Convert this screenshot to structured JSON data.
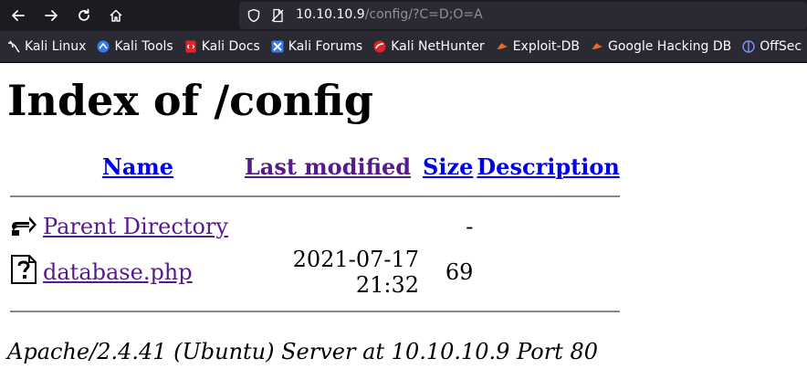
{
  "browser": {
    "url_host": "10.10.10.9",
    "url_path": "/config/?C=D;O=A",
    "bookmarks": [
      {
        "label": "Kali Linux",
        "icon": "kali-dragon-icon"
      },
      {
        "label": "Kali Tools",
        "icon": "kali-tools-icon"
      },
      {
        "label": "Kali Docs",
        "icon": "kali-docs-icon"
      },
      {
        "label": "Kali Forums",
        "icon": "kali-forums-icon"
      },
      {
        "label": "Kali NetHunter",
        "icon": "kali-nethunter-icon"
      },
      {
        "label": "Exploit-DB",
        "icon": "exploit-db-icon"
      },
      {
        "label": "Google Hacking DB",
        "icon": "ghdb-icon"
      },
      {
        "label": "OffSec",
        "icon": "offsec-icon"
      }
    ]
  },
  "page": {
    "title": "Index of /config",
    "columns": {
      "name": "Name",
      "last_modified": "Last modified",
      "size": "Size",
      "description": "Description"
    },
    "rows": [
      {
        "name": "Parent Directory",
        "modified": "",
        "size": "-",
        "description": "",
        "icon": "back-folder-icon"
      },
      {
        "name": "database.php",
        "modified": "2021-07-17 21:32",
        "size": "69",
        "description": "",
        "icon": "unknown-file-icon"
      }
    ],
    "footer": "Apache/2.4.41 (Ubuntu) Server at 10.10.10.9 Port 80"
  }
}
